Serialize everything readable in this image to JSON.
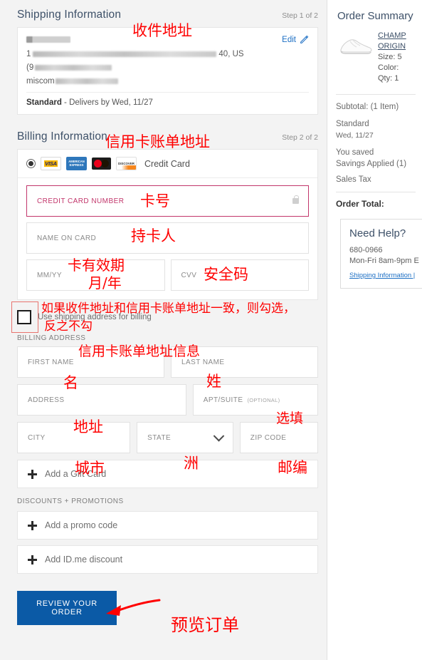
{
  "shipping": {
    "title": "Shipping Information",
    "step": "Step 1 of 2",
    "edit_label": "Edit",
    "address_country": "40, US",
    "address_phone_prefix": "(9",
    "address_email_prefix": "miscom",
    "address_street_prefix": "1",
    "method_name": "Standard",
    "method_detail": "- Delivers by Wed, 11/27"
  },
  "billing": {
    "title": "Billing Information",
    "step": "Step 2 of 2",
    "payment_label": "Credit Card",
    "cards": [
      "VISA",
      "AMERICAN EXPRESS",
      "MasterCard",
      "DISCOVER"
    ],
    "cc_number_label": "CREDIT CARD NUMBER",
    "name_on_card_label": "NAME ON CARD",
    "expiry_label": "MM/YY",
    "cvv_label": "CVV",
    "use_shipping_label": "Use shipping address for billing",
    "billing_address_label": "BILLING ADDRESS",
    "first_name_label": "FIRST NAME",
    "last_name_label": "LAST NAME",
    "address_label": "ADDRESS",
    "apt_label": "APT/SUITE",
    "apt_optional": "(OPTIONAL)",
    "city_label": "CITY",
    "state_label": "STATE",
    "zip_label": "ZIP CODE"
  },
  "extras": {
    "gift_card": "Add a Gift Card",
    "discounts_header": "DISCOUNTS + PROMOTIONS",
    "promo_code": "Add a promo code",
    "idme": "Add ID.me discount"
  },
  "submit": {
    "label": "REVIEW YOUR ORDER"
  },
  "summary": {
    "title": "Order Summary",
    "product_line1": "CHAMP",
    "product_line2": "ORIGIN",
    "size": "Size: 5",
    "color": "Color:",
    "qty": "Qty: 1",
    "subtotal": "Subtotal: (1 Item)",
    "ship_method": "Standard",
    "ship_date": "Wed, 11/27",
    "you_saved": "You saved",
    "savings_applied": "Savings Applied (1)",
    "sales_tax": "Sales Tax",
    "order_total": "Order Total:"
  },
  "help": {
    "title": "Need Help?",
    "phone": "680-0966",
    "hours": "Mon-Fri 8am-9pm E",
    "link": "Shipping Information |"
  },
  "annotations": {
    "shipping_addr": "收件地址",
    "billing_addr": "信用卡账单地址",
    "card_number": "卡号",
    "card_holder": "持卡人",
    "expiry_1": "卡有效期",
    "expiry_2": "月/年",
    "cvv": "安全码",
    "checkbox_1": "如果收件地址和信用卡账单地址一致，则勾选，",
    "checkbox_2": "反之不勾",
    "billing_info": "信用卡账单地址信息",
    "first_name": "名",
    "last_name": "姓",
    "address": "地址",
    "optional": "选填",
    "city": "城市",
    "state": "洲",
    "zip": "邮编",
    "review": "预览订单"
  },
  "colors": {
    "accent_blue": "#0b5aa6",
    "heading": "#3d5068",
    "cc_border": "#c2366b",
    "annotation": "#ff0000"
  }
}
